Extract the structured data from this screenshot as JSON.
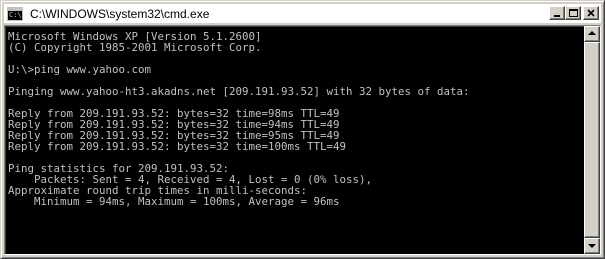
{
  "window": {
    "title": "C:\\WINDOWS\\system32\\cmd.exe",
    "icon": "cmd-icon",
    "icon_text": "C:\\"
  },
  "caption_buttons": {
    "minimize": "minimize-icon",
    "maximize": "maximize-icon",
    "close": "close-icon"
  },
  "console": {
    "text_color": "#c0c0c0",
    "background_color": "#000000",
    "lines": [
      "Microsoft Windows XP [Version 5.1.2600]",
      "(C) Copyright 1985-2001 Microsoft Corp.",
      "",
      "U:\\>ping www.yahoo.com",
      "",
      "Pinging www.yahoo-ht3.akadns.net [209.191.93.52] with 32 bytes of data:",
      "",
      "Reply from 209.191.93.52: bytes=32 time=98ms TTL=49",
      "Reply from 209.191.93.52: bytes=32 time=94ms TTL=49",
      "Reply from 209.191.93.52: bytes=32 time=95ms TTL=49",
      "Reply from 209.191.93.52: bytes=32 time=100ms TTL=49",
      "",
      "Ping statistics for 209.191.93.52:",
      "    Packets: Sent = 4, Received = 4, Lost = 0 (0% loss),",
      "Approximate round trip times in milli-seconds:",
      "    Minimum = 94ms, Maximum = 100ms, Average = 96ms"
    ]
  },
  "scrollbar": {
    "up": "scroll-up-arrow-icon",
    "down": "scroll-down-arrow-icon"
  }
}
